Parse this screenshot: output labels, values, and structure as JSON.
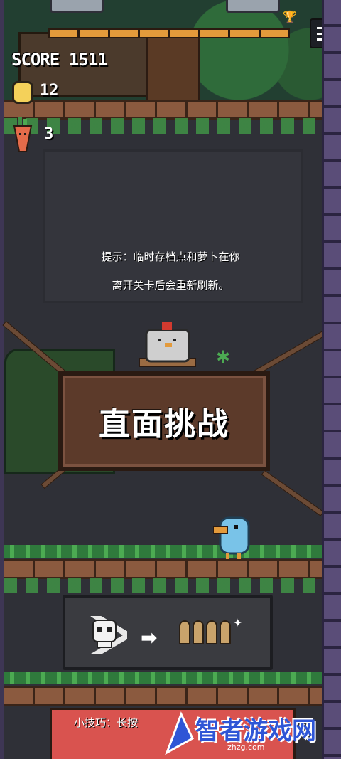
{
  "hud": {
    "score_label": "SCORE 1511",
    "coin_count": "12",
    "carrot_count": "3"
  },
  "hint": {
    "line1": "提示：临时存档点和萝卜在你",
    "line2": "离开关卡后会重新刷新。"
  },
  "sign": {
    "label": "直面挑战"
  },
  "bottom_tip": "小技巧：长按",
  "watermark": {
    "brand": "智者游戏网",
    "url": "zhzg.com"
  },
  "colors": {
    "accent": "#e39a3b",
    "sign": "#5c3a2a",
    "coin": "#f4d15a"
  },
  "icons": [
    "menu-icon",
    "coin-icon",
    "carrot-icon",
    "trophy-icon",
    "chicken-icon",
    "bird-icon",
    "skull-icon",
    "arrow-icon",
    "ammo-icon"
  ]
}
